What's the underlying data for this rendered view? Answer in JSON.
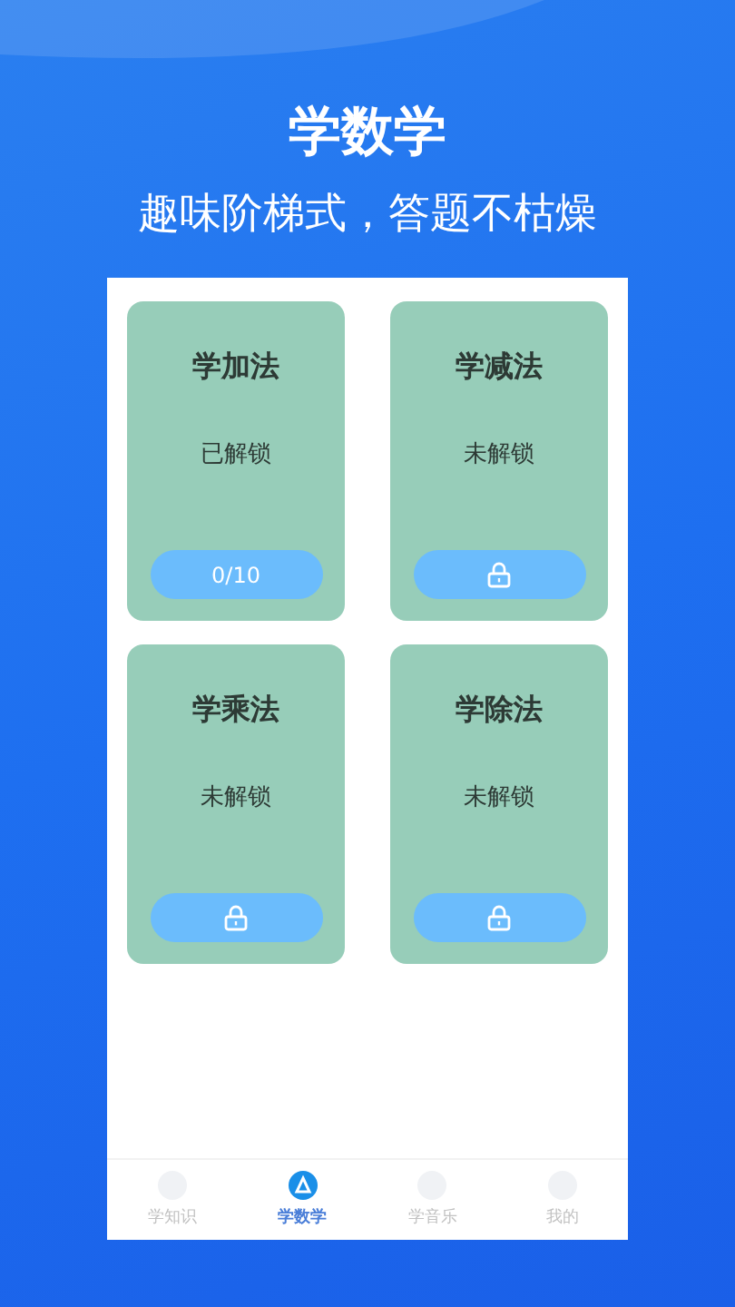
{
  "header": {
    "title": "学数学",
    "subtitle": "趣味阶梯式，答题不枯燥"
  },
  "lessons": [
    {
      "title": "学加法",
      "status": "已解锁",
      "locked": false,
      "progress": "0/10"
    },
    {
      "title": "学减法",
      "status": "未解锁",
      "locked": true
    },
    {
      "title": "学乘法",
      "status": "未解锁",
      "locked": true
    },
    {
      "title": "学除法",
      "status": "未解锁",
      "locked": true
    }
  ],
  "tabs": [
    {
      "label": "学知识",
      "selected": false
    },
    {
      "label": "学数学",
      "selected": true
    },
    {
      "label": "学音乐",
      "selected": false
    },
    {
      "label": "我的",
      "selected": false
    }
  ]
}
